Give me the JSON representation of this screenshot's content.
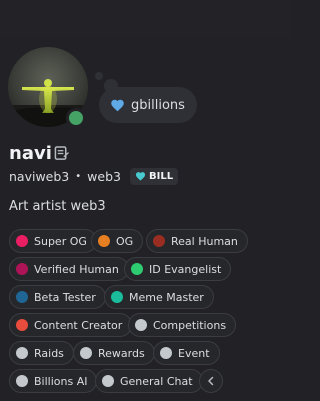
{
  "profile": {
    "display_name": "navi",
    "username": "naviweb3",
    "pronoun_or_tag": "web3",
    "separator": "•",
    "clan_tag": "BILL",
    "bio": "Art artist web3",
    "status": "online",
    "custom_status": "gbillions"
  },
  "colors": {
    "status_online": "#45a366",
    "heart": "#5fa9e6",
    "tag_heart": "#47c9cf"
  },
  "roles": [
    {
      "label": "Super OG",
      "color": "#e91e63"
    },
    {
      "label": "OG",
      "color": "#e67e22"
    },
    {
      "label": "Real Human",
      "color": "#992d22"
    },
    {
      "label": "Verified Human",
      "color": "#ad1457"
    },
    {
      "label": "ID Evangelist",
      "color": "#2ecc71"
    },
    {
      "label": "Beta Tester",
      "color": "#206694"
    },
    {
      "label": "Meme Master",
      "color": "#1abc9c"
    },
    {
      "label": "Content Creator",
      "color": "#e74c3c"
    },
    {
      "label": "Competitions",
      "color": "#c4c9ce"
    },
    {
      "label": "Raids",
      "color": "#c4c9ce"
    },
    {
      "label": "Rewards",
      "color": "#c4c9ce"
    },
    {
      "label": "Event",
      "color": "#c4c9ce"
    },
    {
      "label": "Billions AI",
      "color": "#c4c9ce"
    },
    {
      "label": "General Chat",
      "color": "#c4c9ce"
    }
  ],
  "icons": {
    "notes": "notes-icon",
    "collapse": "chevron-left-icon",
    "heart": "heart-icon"
  }
}
